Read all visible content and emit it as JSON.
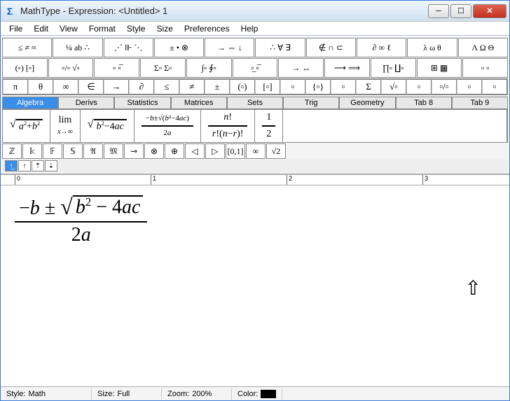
{
  "title": "MathType - Expression: <Untitled> 1",
  "menu": [
    "File",
    "Edit",
    "View",
    "Format",
    "Style",
    "Size",
    "Preferences",
    "Help"
  ],
  "palette1": [
    "≤ ≠ ≈",
    "¼ ab ∴",
    "⋰ ⊪ ⋱",
    "± • ⊗",
    "→ ⇔ ↓",
    "∴ ∀ ∃",
    "∉ ∩ ⊂",
    "∂ ∞ ℓ",
    "λ ω θ",
    "Λ Ω Θ"
  ],
  "palette2": [
    "(▫) [▫]",
    "▫/▫ √▫",
    "▫ ▫̅",
    "Σ▫ Σ▫",
    "∫▫ ∮▫",
    "▫̲ ▫̅",
    "→ ↔",
    "⟶ ⟹",
    "∏▫ ∐▫",
    "⊞ ▦",
    "▫ ▫"
  ],
  "palette3": [
    "π",
    "θ",
    "∞",
    "∈",
    "→",
    "∂",
    "≤",
    "≠",
    "±",
    "(▫)",
    "[▫]",
    "▫",
    "{▫}",
    "▫",
    "Σ",
    "√▫",
    "▫",
    "▫/▫",
    "▫",
    "▫"
  ],
  "tabs": [
    "Algebra",
    "Derivs",
    "Statistics",
    "Matrices",
    "Sets",
    "Trig",
    "Geometry",
    "Tab 8",
    "Tab 9"
  ],
  "templates": [
    "√(a²+b²)",
    "lim x→∞",
    "√(b²−4ac)",
    "(−b±√(b²−4ac))/2a",
    "n!/(r!(n−r)!)",
    "1/2"
  ],
  "templates2": [
    "ℤ",
    "𝕜",
    "𝔽",
    "𝕊",
    "𝔄",
    "𝔐",
    "⊸",
    "⊗",
    "⊕",
    "◁",
    "▷",
    "[0,1]",
    "∞",
    "√2"
  ],
  "nav": [
    "↑̲",
    "↑",
    "⇡",
    "⇣"
  ],
  "ruler": [
    "0",
    "1",
    "2",
    "3"
  ],
  "expression": {
    "num_pre": "−",
    "num_var1": "b",
    "num_pm": " ± ",
    "rad_var": "b",
    "rad_sup": "2",
    "rad_mid": " − 4",
    "rad_var2": "ac",
    "den_co": "2",
    "den_var": "a"
  },
  "status": {
    "style_label": "Style:",
    "style_val": "Math",
    "size_label": "Size:",
    "size_val": "Full",
    "zoom_label": "Zoom:",
    "zoom_val": "200%",
    "color_label": "Color:"
  },
  "icons": {
    "app": "Σ",
    "min": "─",
    "max": "☐",
    "close": "✕",
    "uparrow": "⇧"
  }
}
